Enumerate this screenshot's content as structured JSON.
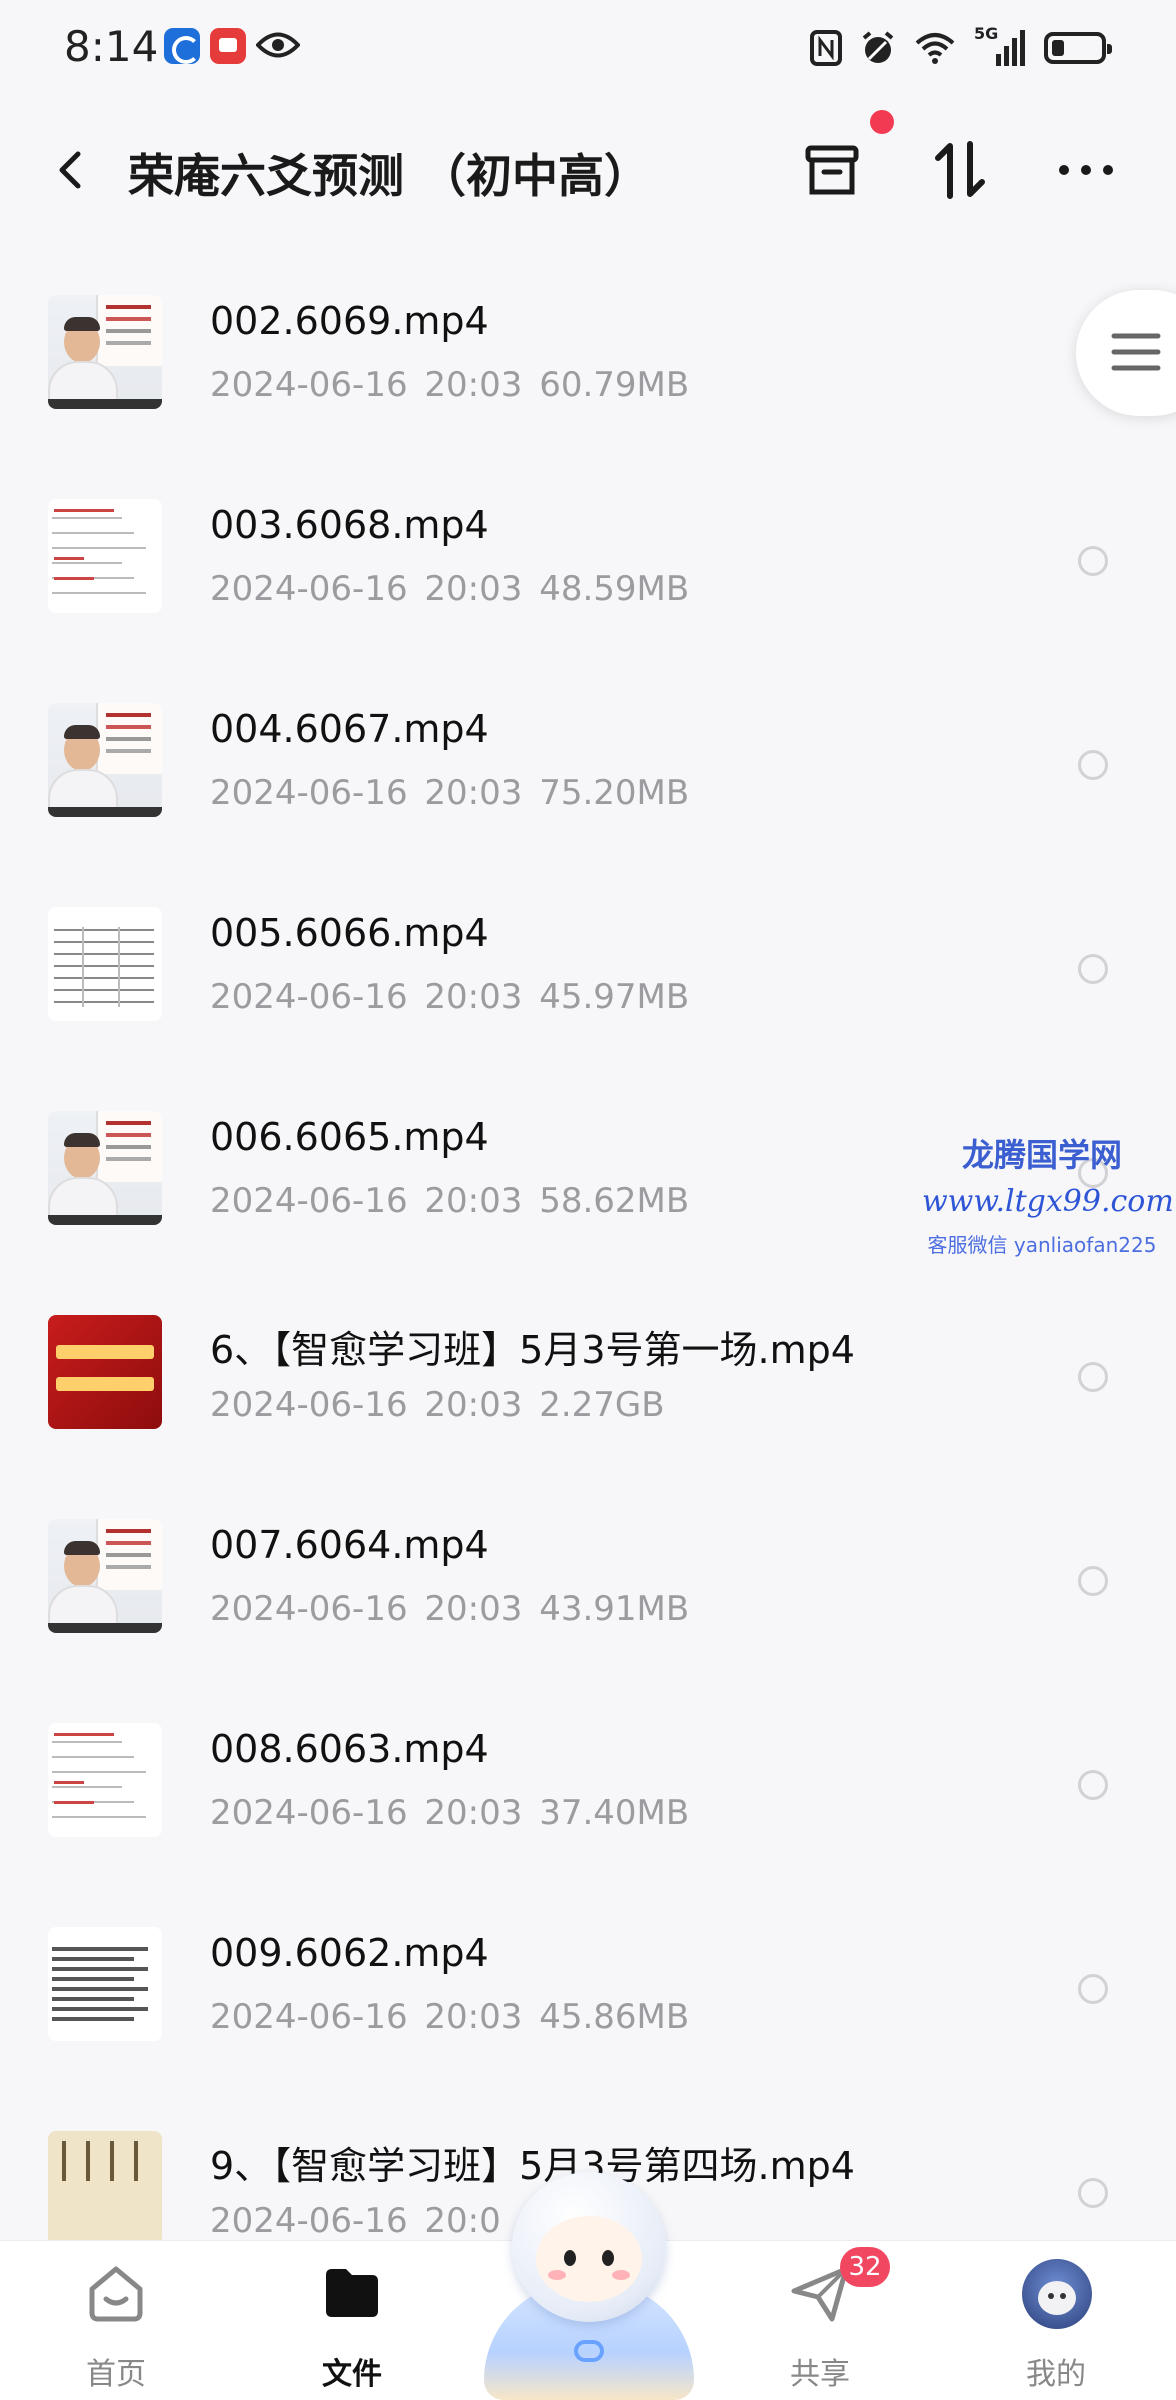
{
  "status_bar": {
    "time": "8:14",
    "network_label": "5G",
    "icons": [
      "app-blue-icon",
      "app-red-icon",
      "eye-icon",
      "nfc-icon",
      "alarm-icon",
      "wifi-icon",
      "signal-icon",
      "battery-icon"
    ]
  },
  "header": {
    "back_icon": "chevron-left-icon",
    "title": "荣庵六爻预测 （初中高）",
    "actions": [
      "box-icon",
      "sort-icon",
      "more-icon"
    ],
    "notification_dot_color": "#f23a52"
  },
  "files": [
    {
      "name": "002.6069.mp4",
      "meta": "2024-06-16  20:03  60.79MB",
      "thumb": "person"
    },
    {
      "name": "003.6068.mp4",
      "meta": "2024-06-16  20:03  48.59MB",
      "thumb": "notes"
    },
    {
      "name": "004.6067.mp4",
      "meta": "2024-06-16  20:03  75.20MB",
      "thumb": "person"
    },
    {
      "name": "005.6066.mp4",
      "meta": "2024-06-16  20:03  45.97MB",
      "thumb": "table"
    },
    {
      "name": "006.6065.mp4",
      "meta": "2024-06-16  20:03  58.62MB",
      "thumb": "person"
    },
    {
      "name": "6、【智愈学习班】5月3号第一场.mp4",
      "meta": "2024-06-16  20:03  2.27GB",
      "thumb": "red"
    },
    {
      "name": "007.6064.mp4",
      "meta": "2024-06-16  20:03  43.91MB",
      "thumb": "person"
    },
    {
      "name": "008.6063.mp4",
      "meta": "2024-06-16  20:03  37.40MB",
      "thumb": "notes"
    },
    {
      "name": "009.6062.mp4",
      "meta": "2024-06-16  20:03  45.86MB",
      "thumb": "text"
    },
    {
      "name": "9、【智愈学习班】5月3号第四场.mp4",
      "meta": "2024-06-16  20:0",
      "thumb": "scroll"
    }
  ],
  "side_handle": {
    "icon": "menu-lines-icon"
  },
  "watermark": {
    "line1": "龙腾国学网",
    "line2": "www.ltgx99.com",
    "line3": "客服微信 yanliaofan225"
  },
  "tabbar": {
    "home": {
      "label": "首页",
      "icon": "home-icon"
    },
    "files": {
      "label": "文件",
      "icon": "folder-icon"
    },
    "share": {
      "label": "共享",
      "icon": "send-icon",
      "badge": "32"
    },
    "me": {
      "label": "我的",
      "icon": "avatar-icon"
    },
    "center": {
      "icon": "mascot-icon"
    }
  },
  "colors": {
    "background": "#f7f7f9",
    "meta_text": "#9b9ba0",
    "badge": "#f24760",
    "watermark": "#3b5fd0"
  }
}
